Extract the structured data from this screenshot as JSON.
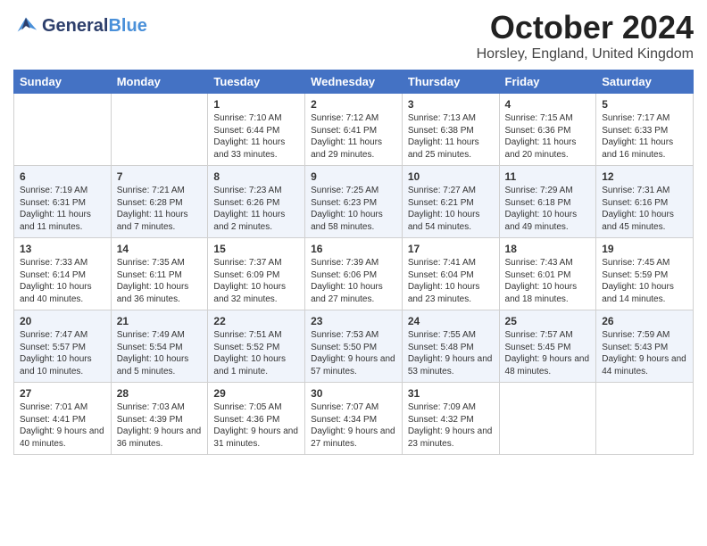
{
  "header": {
    "logo_line1": "General",
    "logo_line2": "Blue",
    "month_title": "October 2024",
    "location": "Horsley, England, United Kingdom"
  },
  "days_of_week": [
    "Sunday",
    "Monday",
    "Tuesday",
    "Wednesday",
    "Thursday",
    "Friday",
    "Saturday"
  ],
  "weeks": [
    [
      {
        "day": "",
        "sunrise": "",
        "sunset": "",
        "daylight": ""
      },
      {
        "day": "",
        "sunrise": "",
        "sunset": "",
        "daylight": ""
      },
      {
        "day": "1",
        "sunrise": "Sunrise: 7:10 AM",
        "sunset": "Sunset: 6:44 PM",
        "daylight": "Daylight: 11 hours and 33 minutes."
      },
      {
        "day": "2",
        "sunrise": "Sunrise: 7:12 AM",
        "sunset": "Sunset: 6:41 PM",
        "daylight": "Daylight: 11 hours and 29 minutes."
      },
      {
        "day": "3",
        "sunrise": "Sunrise: 7:13 AM",
        "sunset": "Sunset: 6:38 PM",
        "daylight": "Daylight: 11 hours and 25 minutes."
      },
      {
        "day": "4",
        "sunrise": "Sunrise: 7:15 AM",
        "sunset": "Sunset: 6:36 PM",
        "daylight": "Daylight: 11 hours and 20 minutes."
      },
      {
        "day": "5",
        "sunrise": "Sunrise: 7:17 AM",
        "sunset": "Sunset: 6:33 PM",
        "daylight": "Daylight: 11 hours and 16 minutes."
      }
    ],
    [
      {
        "day": "6",
        "sunrise": "Sunrise: 7:19 AM",
        "sunset": "Sunset: 6:31 PM",
        "daylight": "Daylight: 11 hours and 11 minutes."
      },
      {
        "day": "7",
        "sunrise": "Sunrise: 7:21 AM",
        "sunset": "Sunset: 6:28 PM",
        "daylight": "Daylight: 11 hours and 7 minutes."
      },
      {
        "day": "8",
        "sunrise": "Sunrise: 7:23 AM",
        "sunset": "Sunset: 6:26 PM",
        "daylight": "Daylight: 11 hours and 2 minutes."
      },
      {
        "day": "9",
        "sunrise": "Sunrise: 7:25 AM",
        "sunset": "Sunset: 6:23 PM",
        "daylight": "Daylight: 10 hours and 58 minutes."
      },
      {
        "day": "10",
        "sunrise": "Sunrise: 7:27 AM",
        "sunset": "Sunset: 6:21 PM",
        "daylight": "Daylight: 10 hours and 54 minutes."
      },
      {
        "day": "11",
        "sunrise": "Sunrise: 7:29 AM",
        "sunset": "Sunset: 6:18 PM",
        "daylight": "Daylight: 10 hours and 49 minutes."
      },
      {
        "day": "12",
        "sunrise": "Sunrise: 7:31 AM",
        "sunset": "Sunset: 6:16 PM",
        "daylight": "Daylight: 10 hours and 45 minutes."
      }
    ],
    [
      {
        "day": "13",
        "sunrise": "Sunrise: 7:33 AM",
        "sunset": "Sunset: 6:14 PM",
        "daylight": "Daylight: 10 hours and 40 minutes."
      },
      {
        "day": "14",
        "sunrise": "Sunrise: 7:35 AM",
        "sunset": "Sunset: 6:11 PM",
        "daylight": "Daylight: 10 hours and 36 minutes."
      },
      {
        "day": "15",
        "sunrise": "Sunrise: 7:37 AM",
        "sunset": "Sunset: 6:09 PM",
        "daylight": "Daylight: 10 hours and 32 minutes."
      },
      {
        "day": "16",
        "sunrise": "Sunrise: 7:39 AM",
        "sunset": "Sunset: 6:06 PM",
        "daylight": "Daylight: 10 hours and 27 minutes."
      },
      {
        "day": "17",
        "sunrise": "Sunrise: 7:41 AM",
        "sunset": "Sunset: 6:04 PM",
        "daylight": "Daylight: 10 hours and 23 minutes."
      },
      {
        "day": "18",
        "sunrise": "Sunrise: 7:43 AM",
        "sunset": "Sunset: 6:01 PM",
        "daylight": "Daylight: 10 hours and 18 minutes."
      },
      {
        "day": "19",
        "sunrise": "Sunrise: 7:45 AM",
        "sunset": "Sunset: 5:59 PM",
        "daylight": "Daylight: 10 hours and 14 minutes."
      }
    ],
    [
      {
        "day": "20",
        "sunrise": "Sunrise: 7:47 AM",
        "sunset": "Sunset: 5:57 PM",
        "daylight": "Daylight: 10 hours and 10 minutes."
      },
      {
        "day": "21",
        "sunrise": "Sunrise: 7:49 AM",
        "sunset": "Sunset: 5:54 PM",
        "daylight": "Daylight: 10 hours and 5 minutes."
      },
      {
        "day": "22",
        "sunrise": "Sunrise: 7:51 AM",
        "sunset": "Sunset: 5:52 PM",
        "daylight": "Daylight: 10 hours and 1 minute."
      },
      {
        "day": "23",
        "sunrise": "Sunrise: 7:53 AM",
        "sunset": "Sunset: 5:50 PM",
        "daylight": "Daylight: 9 hours and 57 minutes."
      },
      {
        "day": "24",
        "sunrise": "Sunrise: 7:55 AM",
        "sunset": "Sunset: 5:48 PM",
        "daylight": "Daylight: 9 hours and 53 minutes."
      },
      {
        "day": "25",
        "sunrise": "Sunrise: 7:57 AM",
        "sunset": "Sunset: 5:45 PM",
        "daylight": "Daylight: 9 hours and 48 minutes."
      },
      {
        "day": "26",
        "sunrise": "Sunrise: 7:59 AM",
        "sunset": "Sunset: 5:43 PM",
        "daylight": "Daylight: 9 hours and 44 minutes."
      }
    ],
    [
      {
        "day": "27",
        "sunrise": "Sunrise: 7:01 AM",
        "sunset": "Sunset: 4:41 PM",
        "daylight": "Daylight: 9 hours and 40 minutes."
      },
      {
        "day": "28",
        "sunrise": "Sunrise: 7:03 AM",
        "sunset": "Sunset: 4:39 PM",
        "daylight": "Daylight: 9 hours and 36 minutes."
      },
      {
        "day": "29",
        "sunrise": "Sunrise: 7:05 AM",
        "sunset": "Sunset: 4:36 PM",
        "daylight": "Daylight: 9 hours and 31 minutes."
      },
      {
        "day": "30",
        "sunrise": "Sunrise: 7:07 AM",
        "sunset": "Sunset: 4:34 PM",
        "daylight": "Daylight: 9 hours and 27 minutes."
      },
      {
        "day": "31",
        "sunrise": "Sunrise: 7:09 AM",
        "sunset": "Sunset: 4:32 PM",
        "daylight": "Daylight: 9 hours and 23 minutes."
      },
      {
        "day": "",
        "sunrise": "",
        "sunset": "",
        "daylight": ""
      },
      {
        "day": "",
        "sunrise": "",
        "sunset": "",
        "daylight": ""
      }
    ]
  ]
}
